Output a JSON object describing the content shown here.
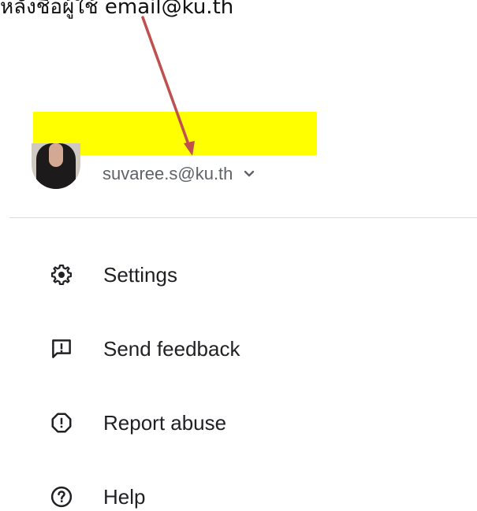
{
  "caption": {
    "text": "หลังชื่อผู้ใช้ email@ku.th"
  },
  "account": {
    "email": "suvaree.s@ku.th",
    "avatar_icon": "user-avatar",
    "expand_icon": "chevron-down-icon"
  },
  "menu": {
    "items": [
      {
        "label": "Settings",
        "icon": "gear-icon"
      },
      {
        "label": "Send feedback",
        "icon": "feedback-icon"
      },
      {
        "label": "Report abuse",
        "icon": "report-icon"
      },
      {
        "label": "Help",
        "icon": "help-icon"
      }
    ]
  },
  "colors": {
    "highlight": "#ffff00",
    "arrow": "#c0504d",
    "text_primary": "#202124",
    "text_secondary": "#5f6368",
    "divider": "#dadce0"
  }
}
